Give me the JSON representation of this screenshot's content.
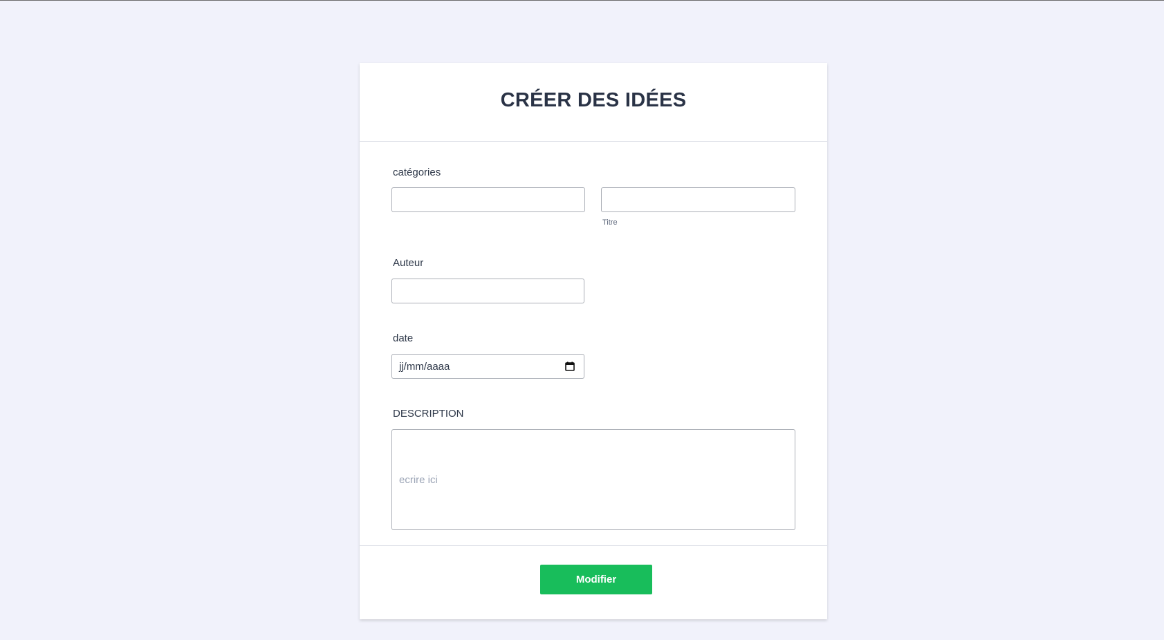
{
  "form": {
    "title": "CRÉER DES IDÉES",
    "categories_label": "catégories",
    "categories_value": "",
    "titre_value": "",
    "titre_hint": "Titre",
    "auteur_label": "Auteur",
    "auteur_value": "",
    "date_label": "date",
    "date_placeholder": "jj/mm/aaaa",
    "description_label": "DESCRIPTION",
    "description_placeholder": "ecrire ici",
    "submit_label": "Modifier"
  },
  "icons": {
    "date_picker": "calendar-icon"
  },
  "colors": {
    "background": "#f1f2fb",
    "submit_button": "#18bd5b",
    "title_text": "#2a3346"
  }
}
